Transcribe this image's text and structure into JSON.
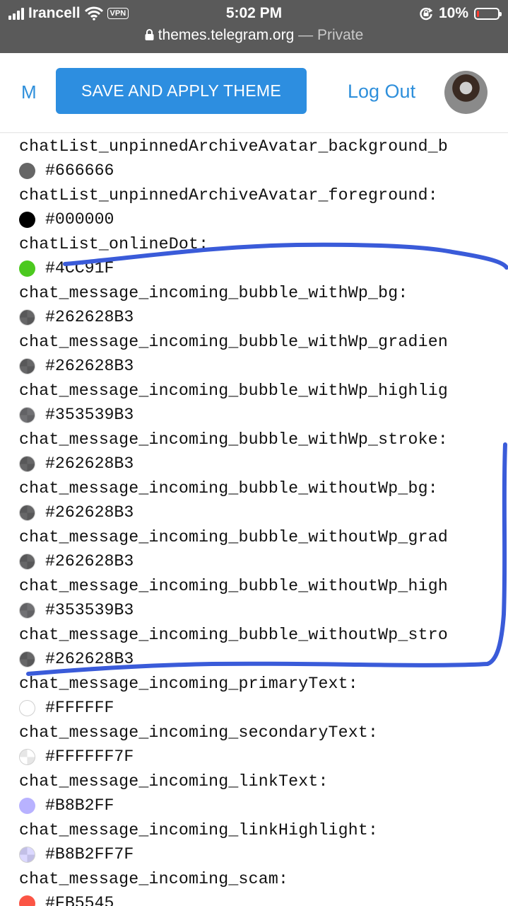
{
  "status_bar": {
    "carrier": "Irancell",
    "vpn_label": "VPN",
    "time": "5:02 PM",
    "battery_percent": "10%",
    "battery_level": 0.1
  },
  "url_bar": {
    "host": "themes.telegram.org",
    "separator": " — ",
    "private_label": "Private"
  },
  "header": {
    "brand_letter": "M",
    "save_button": "SAVE AND APPLY THEME",
    "logout_link": "Log Out"
  },
  "colors": {
    "accent": "#2d8ee0",
    "annotation_stroke": "#3a5bd9"
  },
  "entries": [
    {
      "key": "chatList_unpinnedArchiveAvatar_background_b",
      "hex": "#666666",
      "color": "#666666",
      "alpha": 1
    },
    {
      "key": "chatList_unpinnedArchiveAvatar_foreground:",
      "hex": "#000000",
      "color": "#000000",
      "alpha": 1
    },
    {
      "key": "chatList_onlineDot:",
      "hex": "#4CC91F",
      "color": "#4CC91F",
      "alpha": 1
    },
    {
      "key": "chat_message_incoming_bubble_withWp_bg:",
      "hex": "#262628B3",
      "color": "#262628",
      "alpha": 0.7
    },
    {
      "key": "chat_message_incoming_bubble_withWp_gradien",
      "hex": "#262628B3",
      "color": "#262628",
      "alpha": 0.7
    },
    {
      "key": "chat_message_incoming_bubble_withWp_highlig",
      "hex": "#353539B3",
      "color": "#353539",
      "alpha": 0.7
    },
    {
      "key": "chat_message_incoming_bubble_withWp_stroke:",
      "hex": "#262628B3",
      "color": "#262628",
      "alpha": 0.7
    },
    {
      "key": "chat_message_incoming_bubble_withoutWp_bg:",
      "hex": "#262628B3",
      "color": "#262628",
      "alpha": 0.7
    },
    {
      "key": "chat_message_incoming_bubble_withoutWp_grad",
      "hex": "#262628B3",
      "color": "#262628",
      "alpha": 0.7
    },
    {
      "key": "chat_message_incoming_bubble_withoutWp_high",
      "hex": "#353539B3",
      "color": "#353539",
      "alpha": 0.7
    },
    {
      "key": "chat_message_incoming_bubble_withoutWp_stro",
      "hex": "#262628B3",
      "color": "#262628",
      "alpha": 0.7
    },
    {
      "key": "chat_message_incoming_primaryText:",
      "hex": "#FFFFFF",
      "color": "#FFFFFF",
      "alpha": 1
    },
    {
      "key": "chat_message_incoming_secondaryText:",
      "hex": "#FFFFFF7F",
      "color": "#FFFFFF",
      "alpha": 0.5
    },
    {
      "key": "chat_message_incoming_linkText:",
      "hex": "#B8B2FF",
      "color": "#B8B2FF",
      "alpha": 1
    },
    {
      "key": "chat_message_incoming_linkHighlight:",
      "hex": "#B8B2FF7F",
      "color": "#B8B2FF",
      "alpha": 0.5
    },
    {
      "key": "chat_message_incoming_scam:",
      "hex": "#FB5545",
      "color": "#FB5545",
      "alpha": 1
    }
  ]
}
